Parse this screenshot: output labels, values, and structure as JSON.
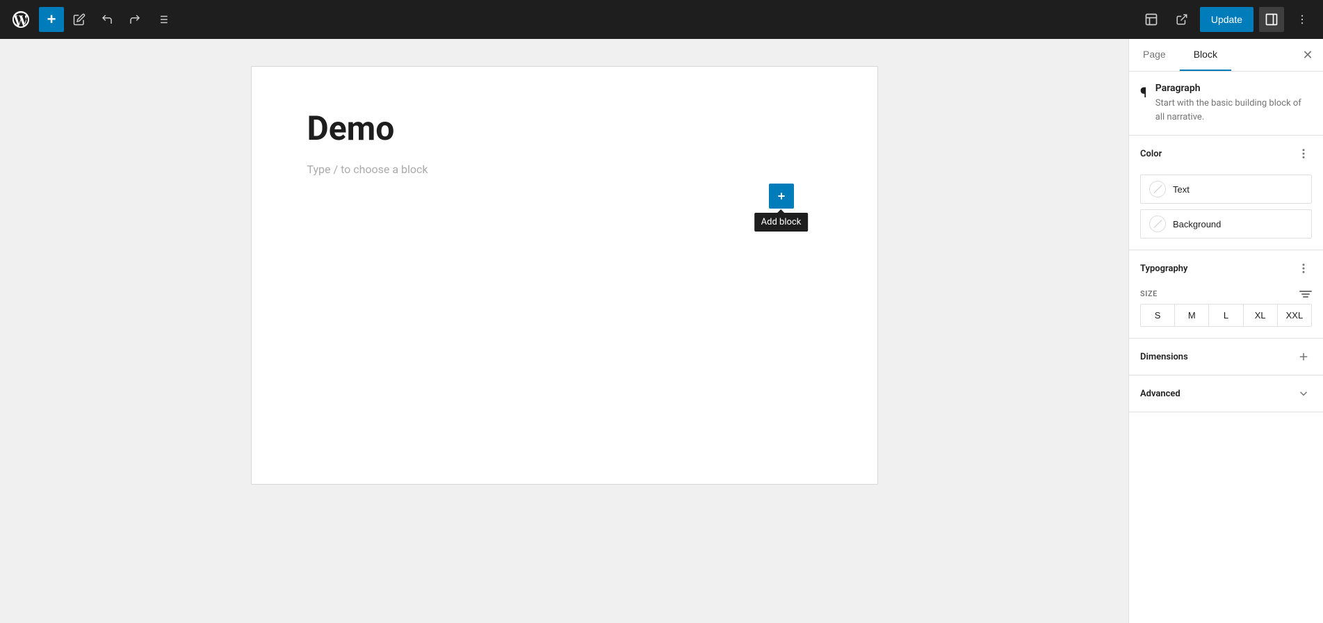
{
  "toolbar": {
    "add_label": "+",
    "undo_label": "↩",
    "redo_label": "↪",
    "list_label": "☰",
    "update_label": "Update",
    "view_label": "⬜",
    "external_label": "↗",
    "more_label": "⋮",
    "sidebar_toggle_label": "▣"
  },
  "editor": {
    "title": "Demo",
    "placeholder": "Type / to choose a block",
    "add_block_tooltip": "Add block"
  },
  "sidebar": {
    "tab_page": "Page",
    "tab_block": "Block",
    "close_label": "✕",
    "paragraph": {
      "title": "Paragraph",
      "description": "Start with the basic building block of all narrative."
    },
    "color": {
      "title": "Color",
      "text_label": "Text",
      "background_label": "Background"
    },
    "typography": {
      "title": "Typography",
      "size_label": "SIZE",
      "sizes": [
        "S",
        "M",
        "L",
        "XL",
        "XXL"
      ]
    },
    "dimensions": {
      "title": "Dimensions"
    },
    "advanced": {
      "title": "Advanced"
    }
  }
}
